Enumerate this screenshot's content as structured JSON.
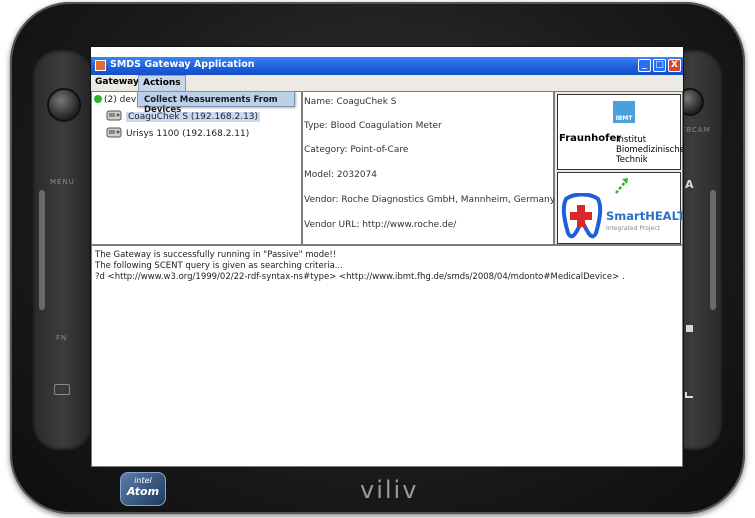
{
  "device": {
    "brand": "viliv",
    "cpu_badge_top": "intel",
    "cpu_badge_bottom": "Atom",
    "hw_left_labels": [
      "MENU",
      "FN"
    ],
    "hw_right_labels": [
      "WEBCAM",
      "A",
      "B",
      "C"
    ]
  },
  "window": {
    "title": "SMDS Gateway Application",
    "controls": {
      "minimize": "_",
      "maximize": "□",
      "close": "X"
    }
  },
  "menubar": {
    "items": [
      "Gateway",
      "Actions"
    ],
    "open_menu_item": "Collect Measurements From Devices"
  },
  "tree": {
    "root": "(2) devic",
    "devices": [
      {
        "label": "CoaguChek S (192.168.2.13)",
        "selected": true
      },
      {
        "label": "Urisys 1100 (192.168.2.11)",
        "selected": false
      }
    ]
  },
  "details": {
    "name": "Name: CoaguChek S",
    "type": "Type: Blood Coagulation Meter",
    "category": "Category: Point-of-Care",
    "model": "Model: 2032074",
    "vendor": "Vendor: Roche Diagnostics GmbH, Mannheim, Germany",
    "vendor_url": "Vendor URL: http://www.roche.de/"
  },
  "logos": {
    "ibmt": "IBMT",
    "fraunhofer": "Fraunhofer",
    "institute_lines": [
      "Institut",
      "Biomedizinische",
      "Technik"
    ],
    "smarthealth": "SmartHEALTH",
    "smarthealth_sub": "Integrated Project"
  },
  "log": {
    "lines": [
      "The Gateway is successfully running in \"Passive\" mode!!",
      "The following SCENT query is given as searching criteria...",
      "?d <http://www.w3.org/1999/02/22-rdf-syntax-ns#type> <http://www.ibmt.fhg.de/smds/2008/04/mdonto#MedicalDevice> ."
    ]
  },
  "colors": {
    "titlebar": "#1f5fdc",
    "menu_highlight": "#bcd0ea",
    "status_dot": "#2bb42b",
    "smarthealth_blue": "#2f6fc4"
  }
}
